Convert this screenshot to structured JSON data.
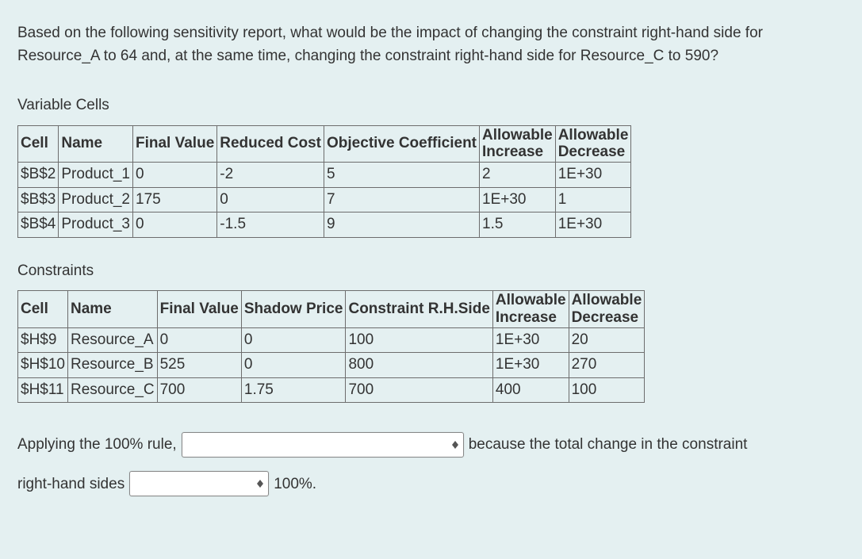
{
  "question": "Based on the following sensitivity report, what would be the impact of changing the constraint right-hand side for Resource_A to 64 and, at the same time, changing the constraint right-hand side for Resource_C to 590?",
  "varcells": {
    "title": "Variable Cells",
    "headers": [
      "Cell",
      "Name",
      "Final Value",
      "Reduced Cost",
      "Objective Coefficient",
      "Allowable Increase",
      "Allowable Decrease"
    ],
    "rows": [
      [
        "$B$2",
        "Product_1",
        "0",
        "-2",
        "5",
        "2",
        "1E+30"
      ],
      [
        "$B$3",
        "Product_2",
        "175",
        "0",
        "7",
        "1E+30",
        "1"
      ],
      [
        "$B$4",
        "Product_3",
        "0",
        "-1.5",
        "9",
        "1.5",
        "1E+30"
      ]
    ]
  },
  "constraints": {
    "title": "Constraints",
    "headers": [
      "Cell",
      "Name",
      "Final Value",
      "Shadow Price",
      "Constraint R.H.Side",
      "Allowable Increase",
      "Allowable Decrease"
    ],
    "rows": [
      [
        "$H$9",
        "Resource_A",
        "0",
        "0",
        "100",
        "1E+30",
        "20"
      ],
      [
        "$H$10",
        "Resource_B",
        "525",
        "0",
        "800",
        "1E+30",
        "270"
      ],
      [
        "$H$11",
        "Resource_C",
        "700",
        "1.75",
        "700",
        "400",
        "100"
      ]
    ]
  },
  "answer": {
    "pre1": "Applying the 100% rule,",
    "mid1": "because the total change in the constraint",
    "pre2": "right-hand sides",
    "tail": "100%."
  }
}
